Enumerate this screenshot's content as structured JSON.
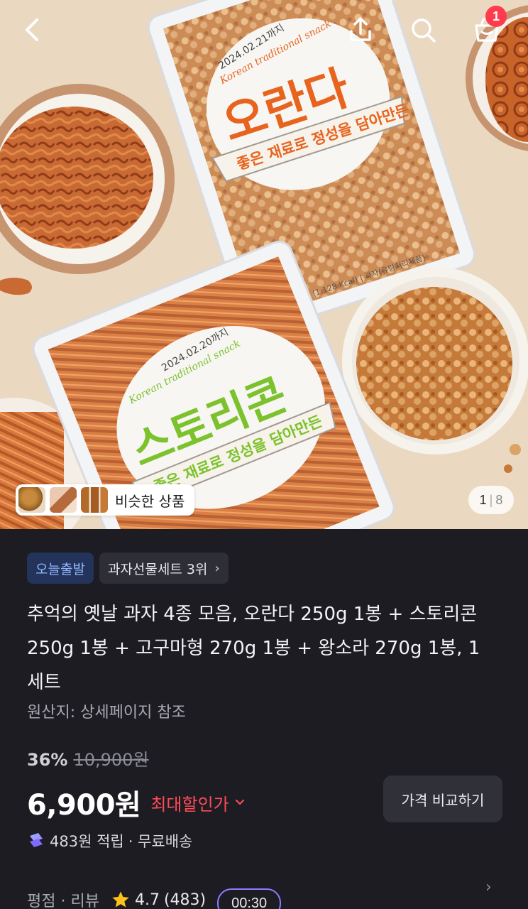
{
  "header": {
    "back_icon": "chevron-left-icon",
    "share_icon": "share-icon",
    "search_icon": "search-icon",
    "cart_icon": "shopping-bag-icon",
    "cart_badge": "1"
  },
  "hero": {
    "bag1_brand": "오란다",
    "bag1_script": "Korean traditional snack",
    "bag1_date": "2024.02.21까지",
    "bag1_ribbon": "좋은 재료로 정성을 담아만든",
    "bag1_footer": "250 g (1,128 Kcal) | 과자(유탕처리제품)",
    "bag2_brand": "스토리콘",
    "bag2_script": "Korean traditional snack",
    "bag2_date": "2024.02.20까지",
    "bag2_ribbon": "좋은 재료로 정성을 담아만든",
    "similar_label": "비슷한 상품",
    "page_current": "1",
    "page_separator": "|",
    "page_total": "8"
  },
  "tags": {
    "today_ship": "오늘출발",
    "category_rank": "과자선물세트 3위"
  },
  "product": {
    "title": "추억의 옛날 과자 4종 모음, 오란다 250g 1봉 + 스토리콘 250g 1봉 + 고구마형 270g 1봉 + 왕소라 270g 1봉, 1세트",
    "origin": "원산지: 상세페이지 참조"
  },
  "pricing": {
    "discount_percent": "36%",
    "original_price": "10,900원",
    "sale_price": "6,900원",
    "best_discount_label": "최대할인가",
    "compare_button": "가격 비교하기",
    "points": "483원 적립",
    "delivery": "· 무료배송"
  },
  "reviews": {
    "label": "평점 · 리뷰",
    "rating": "4.7",
    "count": "(483)",
    "timer": "00:30"
  },
  "colors": {
    "accent_red": "#ff4a58",
    "tag_blue": "#8fb6ff",
    "background": "#1c1c22",
    "green_brand": "#7cc22c",
    "orange_brand": "#e8641e"
  }
}
